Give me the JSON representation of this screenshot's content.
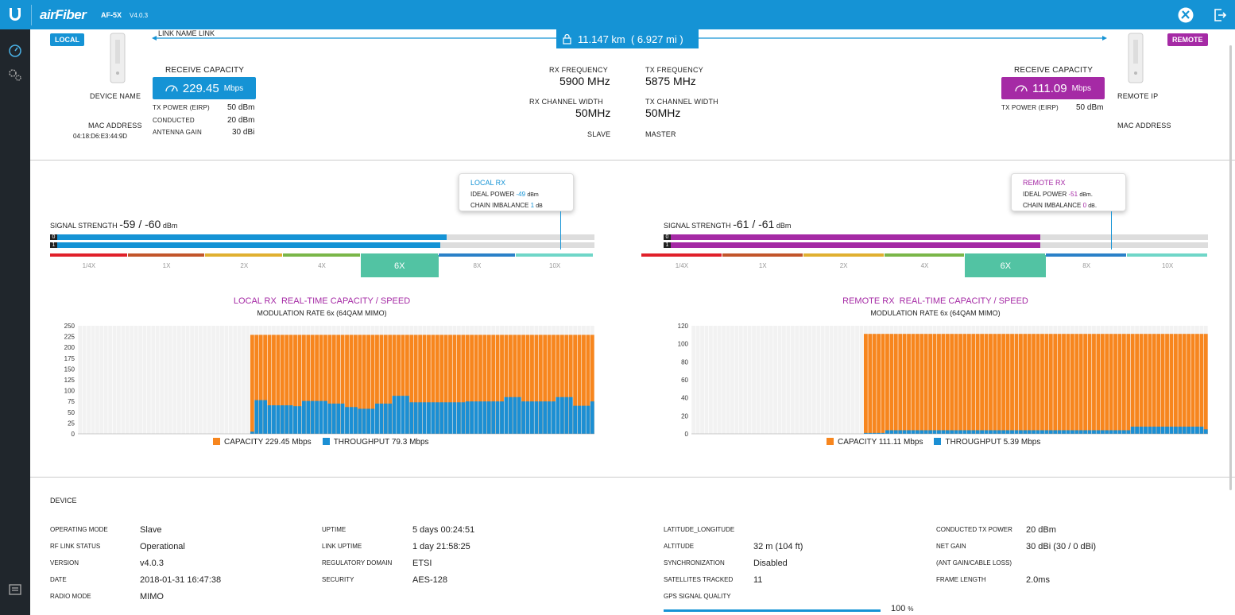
{
  "header": {
    "brand": "airFiber",
    "model": "AF-5X",
    "version": "V4.0.3",
    "bg_color": "#1593d5"
  },
  "icons": {
    "logo": "ubiquiti-u-logo",
    "tools": "tools-icon",
    "logout": "logout-icon",
    "dashboard": "dashboard-gauge-icon",
    "settings": "gears-icon",
    "log": "log-icon"
  },
  "link": {
    "name": "LINK NAME LINK",
    "distance": "11.147 km  ( 6.927 mi )"
  },
  "local": {
    "badge": "LOCAL",
    "device_name_label": "DEVICE NAME",
    "mac_label": "MAC ADDRESS",
    "mac_value": "04:18:D6:E3:44:9D",
    "receive_capacity_label": "RECEIVE CAPACITY",
    "receive_capacity_value": "229.45",
    "receive_capacity_unit": "Mbps",
    "tx_power_label": "TX POWER (EIRP)",
    "tx_power_value": "50 dBm",
    "conducted_label": "CONDUCTED",
    "conducted_value": "20 dBm",
    "antenna_gain_label": "ANTENNA GAIN",
    "antenna_gain_value": "30 dBi",
    "color": "#1593d5"
  },
  "remote": {
    "badge": "REMOTE",
    "remote_ip_label": "REMOTE IP",
    "mac_label": "MAC ADDRESS",
    "receive_capacity_label": "RECEIVE CAPACITY",
    "receive_capacity_value": "111.09",
    "receive_capacity_unit": "Mbps",
    "tx_power_label": "TX POWER (EIRP)",
    "tx_power_value": "50 dBm",
    "color": "#a52aa5"
  },
  "frequency": {
    "rx_freq_label": "RX FREQUENCY",
    "rx_freq_value": "5900 MHz",
    "tx_freq_label": "TX FREQUENCY",
    "tx_freq_value": "5875 MHz",
    "rx_width_label": "RX CHANNEL WIDTH",
    "rx_width_value": "50MHz",
    "tx_width_label": "TX CHANNEL WIDTH",
    "tx_width_value": "50MHz",
    "local_role": "SLAVE",
    "remote_role": "MASTER"
  },
  "local_signal": {
    "label": "SIGNAL STRENGTH",
    "value": "-59 / -60",
    "unit": "dBm",
    "chain0_fill": 0.725,
    "chain1_fill": 0.713,
    "ideal_marker": 0.937,
    "tooltip_title": "LOCAL RX",
    "ideal_power_label": "IDEAL POWER",
    "ideal_power_value": "-49",
    "ideal_power_unit": "dBm",
    "chain_imbalance_label": "CHAIN IMBALANCE",
    "chain_imbalance_value": "1",
    "chain_imbalance_unit": "dB"
  },
  "remote_signal": {
    "label": "SIGNAL STRENGTH",
    "value": "-61 / -61",
    "unit": "dBm",
    "chain0_fill": 0.688,
    "chain1_fill": 0.688,
    "ideal_marker": 0.82,
    "tooltip_title": "REMOTE RX",
    "ideal_power_label": "IDEAL POWER",
    "ideal_power_value": "-51",
    "ideal_power_unit": "dBm",
    "ideal_power_suffix": ".",
    "chain_imbalance_label": "CHAIN IMBALANCE",
    "chain_imbalance_value": "0",
    "chain_imbalance_unit": "dB",
    "chain_imbalance_suffix": "."
  },
  "modulation_scale": {
    "labels": [
      "1/4X",
      "1X",
      "2X",
      "4X",
      "6X",
      "8X",
      "10X"
    ],
    "colors": [
      "#e0202a",
      "#c2552a",
      "#e0b030",
      "#7ab648",
      "#52c3a3",
      "#2a80c8",
      "#6fd6c8"
    ],
    "selected_index": 4
  },
  "local_chart": {
    "title_prefix": "LOCAL RX",
    "title_suffix": "REAL-TIME CAPACITY / SPEED",
    "subtitle": "MODULATION RATE 6x (64QAM MIMO)",
    "legend_capacity": "CAPACITY 229.45 Mbps",
    "legend_throughput": "THROUGHPUT 79.3 Mbps"
  },
  "remote_chart": {
    "title_prefix": "REMOTE RX",
    "title_suffix": "REAL-TIME CAPACITY / SPEED",
    "subtitle": "MODULATION RATE 6x (64QAM MIMO)",
    "legend_capacity": "CAPACITY 111.11 Mbps",
    "legend_throughput": "THROUGHPUT 5.39 Mbps"
  },
  "chart_data": [
    {
      "type": "bar",
      "title": "LOCAL RX REAL-TIME CAPACITY / SPEED",
      "subtitle": "MODULATION RATE 6x (64QAM MIMO)",
      "ylim": [
        0,
        250
      ],
      "yticks": [
        0,
        25,
        50,
        75,
        100,
        125,
        150,
        175,
        200,
        225,
        250
      ],
      "bar_count": 120,
      "empty_leading_bars": 40,
      "series": [
        {
          "name": "CAPACITY 229.45 Mbps",
          "color": "#f7861e",
          "values": [
            229,
            229,
            229,
            229,
            229,
            229,
            229,
            229,
            229,
            229,
            229,
            229,
            229,
            229,
            229,
            229,
            229,
            229,
            229,
            229,
            229,
            229,
            229,
            229,
            229,
            229,
            229,
            229,
            229,
            229,
            229,
            229,
            229,
            229,
            229,
            229,
            229,
            229,
            229,
            229,
            229,
            229,
            229,
            229,
            229,
            229,
            229,
            229,
            229,
            229,
            229,
            229,
            229,
            229,
            229,
            229,
            229,
            229,
            229,
            229,
            229,
            229,
            229,
            229,
            229,
            229,
            229,
            229,
            229,
            229,
            229,
            229,
            229,
            229,
            229,
            229,
            229,
            229,
            229,
            229
          ]
        },
        {
          "name": "THROUGHPUT 79.3 Mbps",
          "color": "#1b8fd4",
          "values": [
            5,
            78,
            78,
            78,
            66,
            66,
            66,
            66,
            66,
            66,
            64,
            64,
            76,
            76,
            76,
            76,
            76,
            76,
            70,
            70,
            70,
            70,
            62,
            62,
            62,
            58,
            58,
            58,
            58,
            70,
            70,
            70,
            70,
            88,
            88,
            88,
            88,
            73,
            73,
            73,
            73,
            73,
            73,
            73,
            73,
            73,
            73,
            73,
            73,
            73,
            75,
            75,
            75,
            75,
            75,
            75,
            75,
            75,
            75,
            85,
            85,
            85,
            85,
            75,
            75,
            75,
            75,
            75,
            75,
            75,
            75,
            85,
            85,
            85,
            85,
            65,
            65,
            65,
            65,
            75,
            75,
            75,
            75,
            63,
            63,
            63,
            63,
            65,
            65,
            65,
            65,
            82,
            82
          ]
        }
      ]
    },
    {
      "type": "bar",
      "title": "REMOTE RX REAL-TIME CAPACITY / SPEED",
      "subtitle": "MODULATION RATE 6x (64QAM MIMO)",
      "ylim": [
        0,
        120
      ],
      "yticks": [
        0,
        20,
        40,
        60,
        80,
        100,
        120
      ],
      "bar_count": 120,
      "empty_leading_bars": 40,
      "series": [
        {
          "name": "CAPACITY 111.11 Mbps",
          "color": "#f7861e",
          "values": [
            111,
            111,
            111,
            111,
            111,
            111,
            111,
            111,
            111,
            111,
            111,
            111,
            111,
            111,
            111,
            111,
            111,
            111,
            111,
            111,
            111,
            111,
            111,
            111,
            111,
            111,
            111,
            111,
            111,
            111,
            111,
            111,
            111,
            111,
            111,
            111,
            111,
            111,
            111,
            111,
            111,
            111,
            111,
            111,
            111,
            111,
            111,
            111,
            111,
            111,
            111,
            111,
            111,
            111,
            111,
            111,
            111,
            111,
            111,
            111,
            111,
            111,
            111,
            111,
            111,
            111,
            111,
            111,
            111,
            111,
            111,
            111,
            111,
            111,
            111,
            111,
            111,
            111,
            111,
            111
          ]
        },
        {
          "name": "THROUGHPUT 5.39 Mbps",
          "color": "#1b8fd4",
          "values": [
            1,
            1,
            1,
            1,
            1,
            4,
            4,
            4,
            4,
            4,
            4,
            4,
            4,
            4,
            4,
            4,
            4,
            4,
            4,
            4,
            4,
            4,
            4,
            4,
            4,
            4,
            4,
            4,
            4,
            4,
            4,
            4,
            4,
            4,
            4,
            4,
            4,
            4,
            4,
            4,
            4,
            4,
            4,
            4,
            4,
            4,
            4,
            4,
            4,
            4,
            4,
            4,
            4,
            4,
            4,
            4,
            4,
            4,
            4,
            4,
            4,
            4,
            8,
            8,
            8,
            8,
            8,
            8,
            8,
            8,
            8,
            8,
            8,
            8,
            8,
            8,
            8,
            8,
            8,
            5
          ]
        }
      ]
    }
  ],
  "device": {
    "heading": "DEVICE",
    "col1": [
      {
        "label": "OPERATING MODE",
        "value": "Slave"
      },
      {
        "label": "RF LINK STATUS",
        "value": "Operational"
      },
      {
        "label": "VERSION",
        "value": "v4.0.3"
      },
      {
        "label": "DATE",
        "value": "2018-01-31 16:47:38"
      },
      {
        "label": "RADIO MODE",
        "value": "MIMO"
      }
    ],
    "col2": [
      {
        "label": "UPTIME",
        "value": "5 days 00:24:51"
      },
      {
        "label": "LINK UPTIME",
        "value": "1 day 21:58:25"
      },
      {
        "label": "REGULATORY DOMAIN",
        "value": "ETSI"
      },
      {
        "label": "SECURITY",
        "value": "AES-128"
      }
    ],
    "col3": [
      {
        "label": "LATITUDE_LONGITUDE",
        "value": ""
      },
      {
        "label": "ALTITUDE",
        "value": "32 m (104 ft)"
      },
      {
        "label": "SYNCHRONIZATION",
        "value": "Disabled"
      },
      {
        "label": "SATELLITES TRACKED",
        "value": "11"
      },
      {
        "label": "GPS SIGNAL QUALITY",
        "value": ""
      }
    ],
    "gps_quality_value": "100",
    "gps_quality_unit": "%",
    "gps_quality_fill": 1.0,
    "col4": [
      {
        "label": "CONDUCTED TX POWER",
        "value": "20 dBm"
      },
      {
        "label": "NET GAIN",
        "value": "30 dBi (30 / 0 dBi)"
      },
      {
        "label": "(ANT GAIN/CABLE LOSS)",
        "value": ""
      },
      {
        "label": "FRAME LENGTH",
        "value": "2.0ms"
      }
    ]
  }
}
